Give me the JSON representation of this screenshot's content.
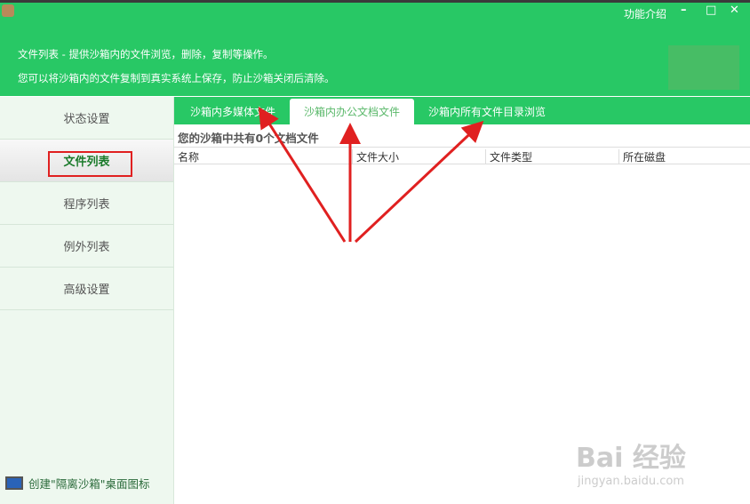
{
  "header": {
    "feature_intro": "功能介绍",
    "minimize": "–",
    "maximize": "□",
    "close": "✕",
    "desc1": "文件列表 - 提供沙箱内的文件浏览，删除，复制等操作。",
    "desc2": "您可以将沙箱内的文件复制到真实系统上保存，防止沙箱关闭后清除。"
  },
  "sidebar": {
    "items": [
      {
        "label": "状态设置"
      },
      {
        "label": "文件列表"
      },
      {
        "label": "程序列表"
      },
      {
        "label": "例外列表"
      },
      {
        "label": "高级设置"
      }
    ],
    "create_shortcut": "创建\"隔离沙箱\"桌面图标"
  },
  "tabs": [
    {
      "label": "沙箱内多媒体文件"
    },
    {
      "label": "沙箱内办公文档文件"
    },
    {
      "label": "沙箱内所有文件目录浏览"
    }
  ],
  "main": {
    "count_text": "您的沙箱中共有0个文档文件",
    "columns": [
      "名称",
      "文件大小",
      "文件类型",
      "所在磁盘"
    ]
  },
  "watermark": {
    "brand": "Bai 经验",
    "url": "jingyan.baidu.com"
  },
  "colors": {
    "accent": "#28c865",
    "annotation": "#e02020"
  }
}
